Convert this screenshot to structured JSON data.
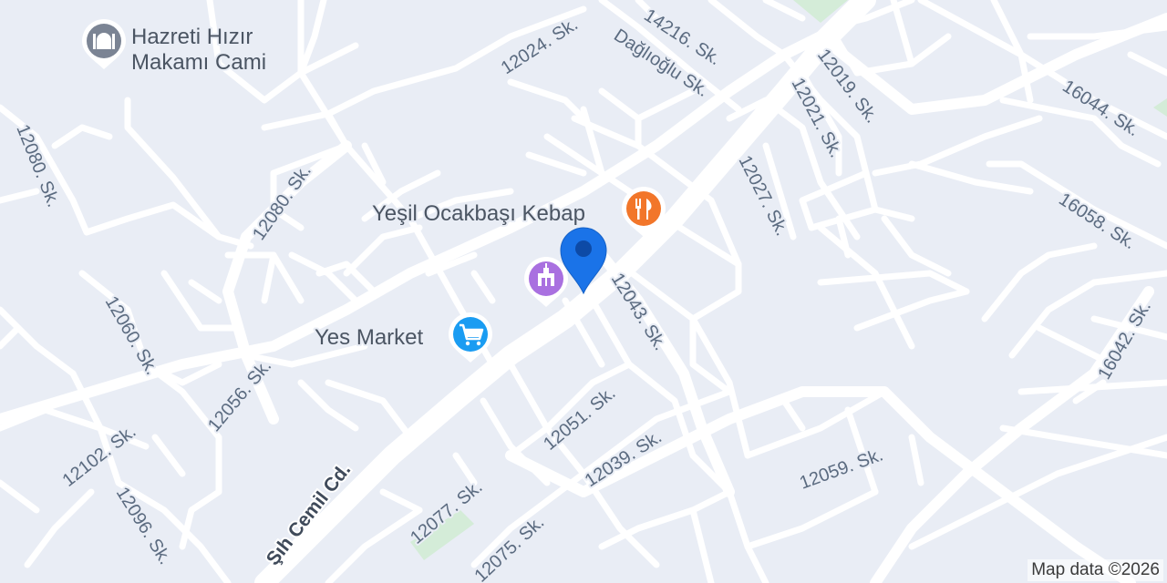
{
  "map": {
    "attribution": "Map data ©2026",
    "colors": {
      "background": "#e9edf5",
      "road": "#ffffff",
      "park": "#d4ecd8",
      "mosque_pin": "#7b8494",
      "restaurant_pin": "#f2762a",
      "attraction_pin": "#a970e0",
      "shopping_pin": "#1a9cf2",
      "location_pin": "#1a73e8"
    },
    "streets": {
      "s12024": "12024. Sk.",
      "s14216": "14216. Sk.",
      "daglioglu": "Dağlıoğlu Sk.",
      "s12019": "12019. Sk.",
      "s16044": "16044. Sk.",
      "s12080a": "12080. Sk.",
      "s12080b": "12080. Sk.",
      "s12021": "12021. Sk.",
      "s12027": "12027. Sk.",
      "s16058": "16058. Sk.",
      "s12060": "12060. Sk.",
      "s12043": "12043. Sk.",
      "s16042": "16042. Sk.",
      "s12056": "12056. Sk.",
      "s12051": "12051. Sk.",
      "s12102": "12102. Sk.",
      "s12039": "12039. Sk.",
      "s12059": "12059. Sk.",
      "s12077": "12077. Sk.",
      "s12096": "12096. Sk.",
      "s12075": "12075. Sk.",
      "semil": "Şıh Cemil Cd."
    },
    "pois": {
      "mosque": {
        "line1": "Hazreti Hızır",
        "line2": "Makamı Cami",
        "icon": "mosque-icon"
      },
      "restaurant": {
        "label": "Yeşil Ocakbaşı Kebap",
        "icon": "restaurant-icon"
      },
      "market": {
        "label": "Yes Market",
        "icon": "shopping-cart-icon"
      },
      "attraction": {
        "icon": "landmark-icon"
      },
      "location": {
        "icon": "location-pin-icon"
      }
    }
  }
}
